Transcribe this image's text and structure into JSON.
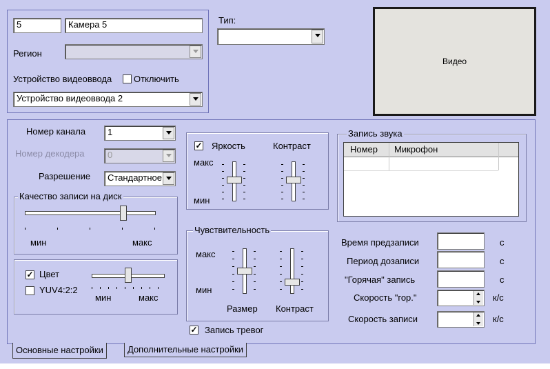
{
  "top": {
    "id_value": "5",
    "name_value": "Камера 5",
    "region_label": "Регион",
    "region_value": "",
    "device_label": "Устройство видеоввода",
    "disable_label": "Отключить",
    "device_value": "Устройство видеоввода 2",
    "type_label": "Тип:",
    "type_value": "",
    "video_label": "Видео"
  },
  "main": {
    "channel_label": "Номер канала",
    "channel_value": "1",
    "decoder_label": "Номер декодера",
    "decoder_value": "0",
    "resolution_label": "Разрешение",
    "resolution_value": "Стандартное",
    "quality_group": "Качество записи на диск",
    "quality_min": "мин",
    "quality_max": "макс",
    "quality_level": 0.73,
    "color_label": "Цвет",
    "color_checked": true,
    "yuv_label": "YUV4:2:2",
    "yuv_checked": false,
    "color_min": "мин",
    "color_max": "макс",
    "color_level": 0.5,
    "brightness_label": "Яркость",
    "brightness_checked": true,
    "contrast_label": "Контраст",
    "bc_max": "макс",
    "bc_min": "мин",
    "sens_group": "Чувствительность",
    "sens_max": "макс",
    "sens_min": "мин",
    "sens_size": "Размер",
    "sens_contrast": "Контраст",
    "alarm_label": "Запись тревог",
    "alarm_checked": true,
    "audio_group": "Запись звука",
    "audio_col_num": "Номер",
    "audio_col_mic": "Микрофон",
    "prerec_label": "Время предзаписи",
    "postrec_label": "Период дозаписи",
    "hot_label": "\"Горячая\" запись",
    "hotspeed_label": "Скорость \"гор.\"",
    "speed_label": "Скорость записи",
    "unit_s": "с",
    "unit_fps": "к/с",
    "prerec_value": "",
    "postrec_value": "",
    "hot_value": "",
    "hotspeed_value": "",
    "speed_value": ""
  },
  "tabs": {
    "basic": "Основные настройки",
    "extra": "Дополнительные настройки"
  }
}
